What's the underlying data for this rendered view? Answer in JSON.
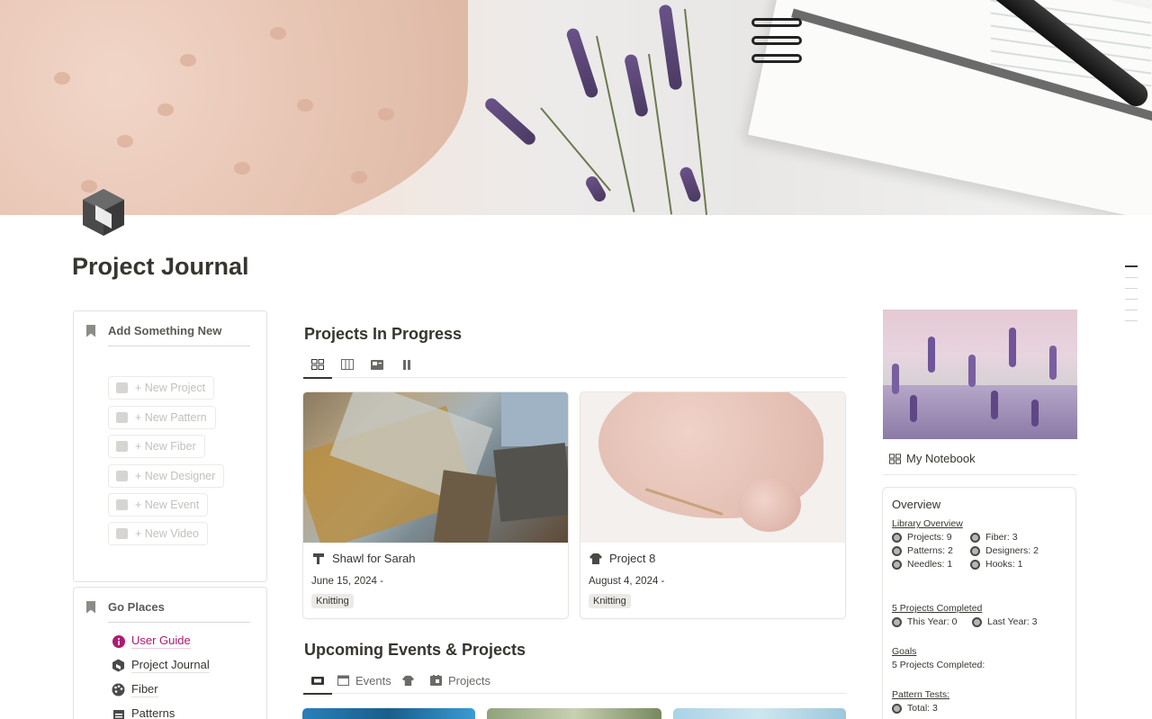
{
  "page": {
    "title": "Project Journal"
  },
  "add_new": {
    "header": "Add Something New",
    "buttons": [
      {
        "label": "+ New Project",
        "icon": "sweater-icon"
      },
      {
        "label": "+ New Pattern",
        "icon": "document-icon"
      },
      {
        "label": "+ New Fiber",
        "icon": "yarn-icon"
      },
      {
        "label": "+ New Designer",
        "icon": "person-icon"
      },
      {
        "label": "+ New Event",
        "icon": "ticket-icon"
      },
      {
        "label": "+ New Video",
        "icon": "video-icon"
      }
    ]
  },
  "go_places": {
    "header": "Go Places",
    "items": [
      {
        "label": "User Guide",
        "icon": "info-icon"
      },
      {
        "label": "Project Journal",
        "icon": "box-icon"
      },
      {
        "label": "Fiber",
        "icon": "palette-icon"
      },
      {
        "label": "Patterns",
        "icon": "calendar-icon"
      }
    ]
  },
  "in_progress": {
    "title": "Projects In Progress",
    "views": [
      "gallery-view-icon",
      "board-view-icon",
      "card-view-icon",
      "pause-view-icon"
    ],
    "cards": [
      {
        "name": "Shawl for Sarah",
        "date": "June 15, 2024 -",
        "tag": "Knitting",
        "icon": "pattern-icon"
      },
      {
        "name": "Project 8",
        "date": "August 4, 2024 -",
        "tag": "Knitting",
        "icon": "sweater-icon"
      }
    ]
  },
  "upcoming": {
    "title": "Upcoming Events & Projects",
    "tabs": [
      {
        "label": "",
        "icon": "ticket-icon"
      },
      {
        "label": "Events",
        "icon": "calendar-icon"
      },
      {
        "label": "",
        "icon": "sweater-icon"
      },
      {
        "label": "Projects",
        "icon": "calendar-icon"
      }
    ]
  },
  "sidebar_right": {
    "notebook_label": "My Notebook",
    "overview": {
      "title": "Overview",
      "library_heading": "Library Overview",
      "library_left": [
        "Projects: 9",
        "Patterns: 2",
        "Needles: 1"
      ],
      "library_right": [
        "Fiber: 3",
        "Designers: 2",
        "Hooks: 1"
      ],
      "completed_heading": "5 Projects Completed",
      "completed_row": [
        "This Year: 0",
        "Last Year: 3"
      ],
      "goals_heading": "Goals",
      "goals_text": "5 Projects Completed:",
      "tests_heading": "Pattern Tests:",
      "tests_total": "Total: 3"
    }
  },
  "colors": {
    "accent_pink": "#ad1a72",
    "text": "#37352f",
    "muted": "#c2c1bd"
  }
}
